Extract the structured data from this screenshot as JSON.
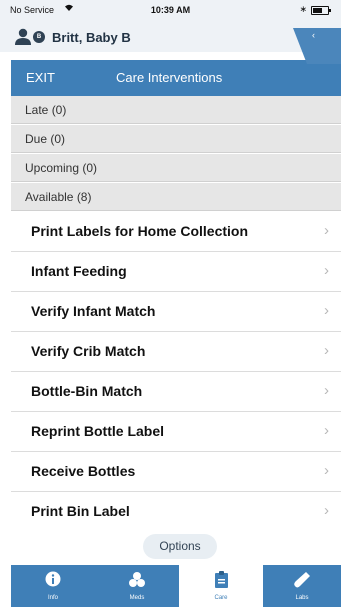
{
  "status_bar": {
    "carrier": "No Service",
    "time": "10:39 AM",
    "bluetooth": "∗"
  },
  "patient": {
    "name": "Britt, Baby B",
    "badge": "B"
  },
  "nav": {
    "exit_label": "EXIT",
    "title": "Care Interventions"
  },
  "groups": [
    {
      "label": "Late (0)"
    },
    {
      "label": "Due (0)"
    },
    {
      "label": "Upcoming (0)"
    },
    {
      "label": "Available (8)"
    }
  ],
  "interventions": [
    {
      "label": "Print Labels for Home Collection"
    },
    {
      "label": "Infant Feeding"
    },
    {
      "label": "Verify Infant Match"
    },
    {
      "label": "Verify Crib Match"
    },
    {
      "label": "Bottle-Bin Match"
    },
    {
      "label": "Reprint Bottle Label"
    },
    {
      "label": "Receive Bottles"
    },
    {
      "label": "Print Bin Label"
    }
  ],
  "options_label": "Options",
  "tabs": [
    {
      "label": "Info",
      "icon": "info-icon"
    },
    {
      "label": "Meds",
      "icon": "pills-icon"
    },
    {
      "label": "Care",
      "icon": "clipboard-icon",
      "active": true
    },
    {
      "label": "Labs",
      "icon": "test-tube-icon"
    }
  ],
  "colors": {
    "accent": "#3f7fb7",
    "header_bg": "#eef2f6",
    "group_bg": "#e6e6e6"
  }
}
